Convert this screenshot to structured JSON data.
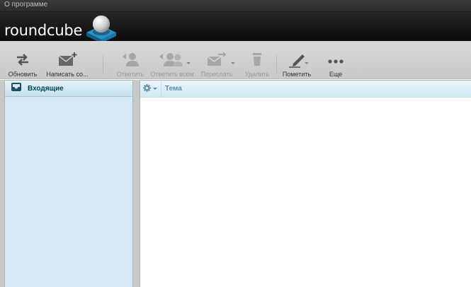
{
  "topline": {
    "about_label": "О программе"
  },
  "header": {
    "logo_text": "roundcube"
  },
  "toolbar": {
    "refresh": "Обновить",
    "compose": "Написать со...",
    "reply": "Ответить",
    "reply_all": "Ответить всем",
    "forward": "Переслать",
    "delete": "Удалить",
    "mark": "Пометить",
    "more": "Еще"
  },
  "folders": [
    {
      "name": "Входящие",
      "selected": true
    }
  ],
  "messagelist": {
    "columns": {
      "subject": "Тема"
    }
  },
  "colors": {
    "accent": "#004458",
    "folder_bg": "#d7eaf3",
    "header_bg": "#111111"
  }
}
